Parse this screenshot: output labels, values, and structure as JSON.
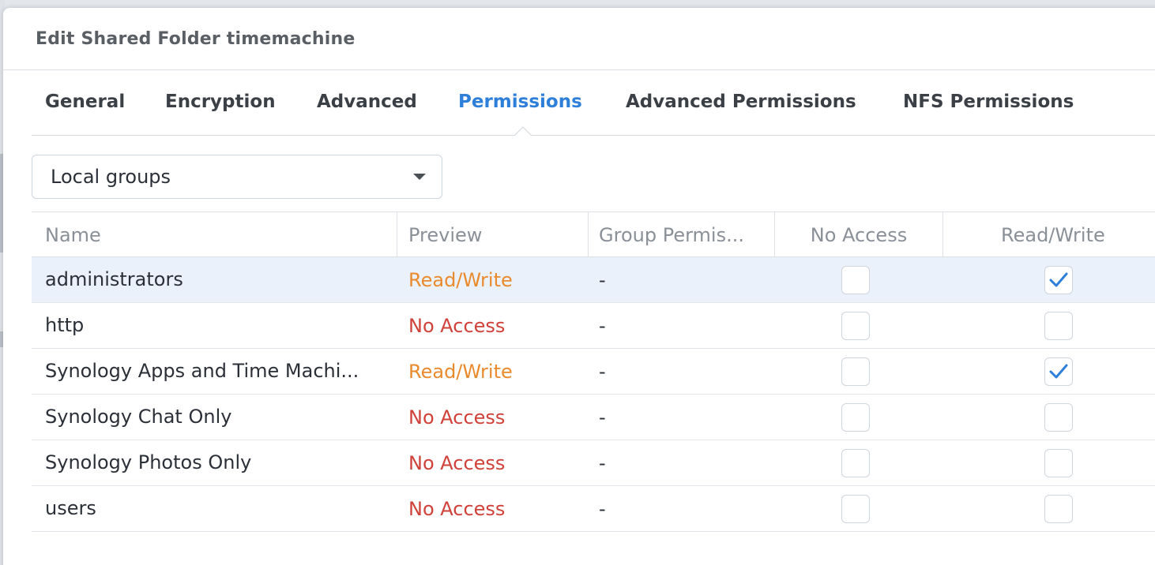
{
  "dialog": {
    "title": "Edit Shared Folder timemachine"
  },
  "tabs": [
    {
      "label": "General",
      "active": false
    },
    {
      "label": "Encryption",
      "active": false
    },
    {
      "label": "Advanced",
      "active": false
    },
    {
      "label": "Permissions",
      "active": true
    },
    {
      "label": "Advanced Permissions",
      "active": false
    },
    {
      "label": "NFS Permissions",
      "active": false
    }
  ],
  "filter": {
    "selected": "Local groups",
    "icon": "chevron-down-icon"
  },
  "table": {
    "columns": [
      "Name",
      "Preview",
      "Group Permis...",
      "No Access",
      "Read/Write"
    ],
    "rows": [
      {
        "name": "administrators",
        "preview": "Read/Write",
        "group": "-",
        "no_access": false,
        "read_write": true,
        "selected": true
      },
      {
        "name": "http",
        "preview": "No Access",
        "group": "-",
        "no_access": false,
        "read_write": false,
        "selected": false
      },
      {
        "name": "Synology Apps and Time Machi...",
        "preview": "Read/Write",
        "group": "-",
        "no_access": false,
        "read_write": true,
        "selected": false
      },
      {
        "name": "Synology Chat Only",
        "preview": "No Access",
        "group": "-",
        "no_access": false,
        "read_write": false,
        "selected": false
      },
      {
        "name": "Synology Photos Only",
        "preview": "No Access",
        "group": "-",
        "no_access": false,
        "read_write": false,
        "selected": false
      },
      {
        "name": "users",
        "preview": "No Access",
        "group": "-",
        "no_access": false,
        "read_write": false,
        "selected": false
      }
    ]
  },
  "colors": {
    "accent": "#2e7fd9",
    "read_write": "#e98a2c",
    "no_access": "#d0413a",
    "selected_row": "#eaf1fb"
  }
}
